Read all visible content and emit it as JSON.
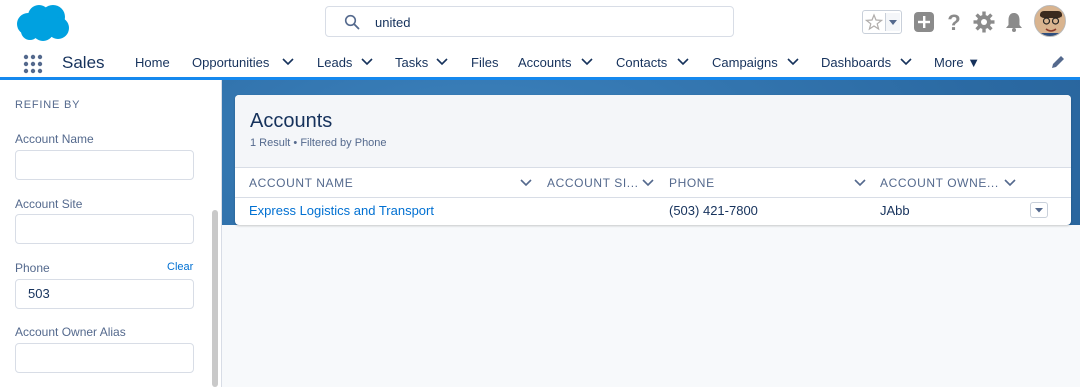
{
  "colors": {
    "brand": "#00a1e0",
    "link": "#0070d2",
    "nav_underline": "#1589ee",
    "text": "#16325c"
  },
  "header": {
    "logo_icon": "salesforce-cloud-icon",
    "search": {
      "value": "united",
      "icon": "search-icon"
    },
    "icons": [
      "favorite-star-icon",
      "add-icon",
      "help-icon",
      "setup-gear-icon",
      "notifications-bell-icon",
      "avatar"
    ]
  },
  "nav": {
    "app_launcher_icon": "waffle-icon",
    "app_name": "Sales",
    "items": [
      {
        "label": "Home",
        "chevron": false
      },
      {
        "label": "Opportunities",
        "chevron": true
      },
      {
        "label": "Leads",
        "chevron": true
      },
      {
        "label": "Tasks",
        "chevron": true
      },
      {
        "label": "Files",
        "chevron": false
      },
      {
        "label": "Accounts",
        "chevron": true
      },
      {
        "label": "Contacts",
        "chevron": true
      },
      {
        "label": "Campaigns",
        "chevron": true
      },
      {
        "label": "Dashboards",
        "chevron": true
      },
      {
        "label": "More ▼",
        "chevron": false
      }
    ],
    "edit_icon": "pencil-icon"
  },
  "sidebar": {
    "title": "REFINE BY",
    "fields": [
      {
        "label": "Account Name",
        "value": ""
      },
      {
        "label": "Account Site",
        "value": ""
      },
      {
        "label": "Phone",
        "value": "503"
      },
      {
        "label": "Account Owner Alias",
        "value": ""
      }
    ],
    "clear_label": "Clear"
  },
  "results": {
    "title": "Accounts",
    "subtitle": "1 Result • Filtered by Phone",
    "columns": [
      "ACCOUNT NAME",
      "ACCOUNT SI...",
      "PHONE",
      "ACCOUNT OWNE..."
    ],
    "rows": [
      {
        "name": "Express Logistics and Transport",
        "site": "",
        "phone": "(503) 421-7800",
        "owner": "JAbb"
      }
    ]
  }
}
